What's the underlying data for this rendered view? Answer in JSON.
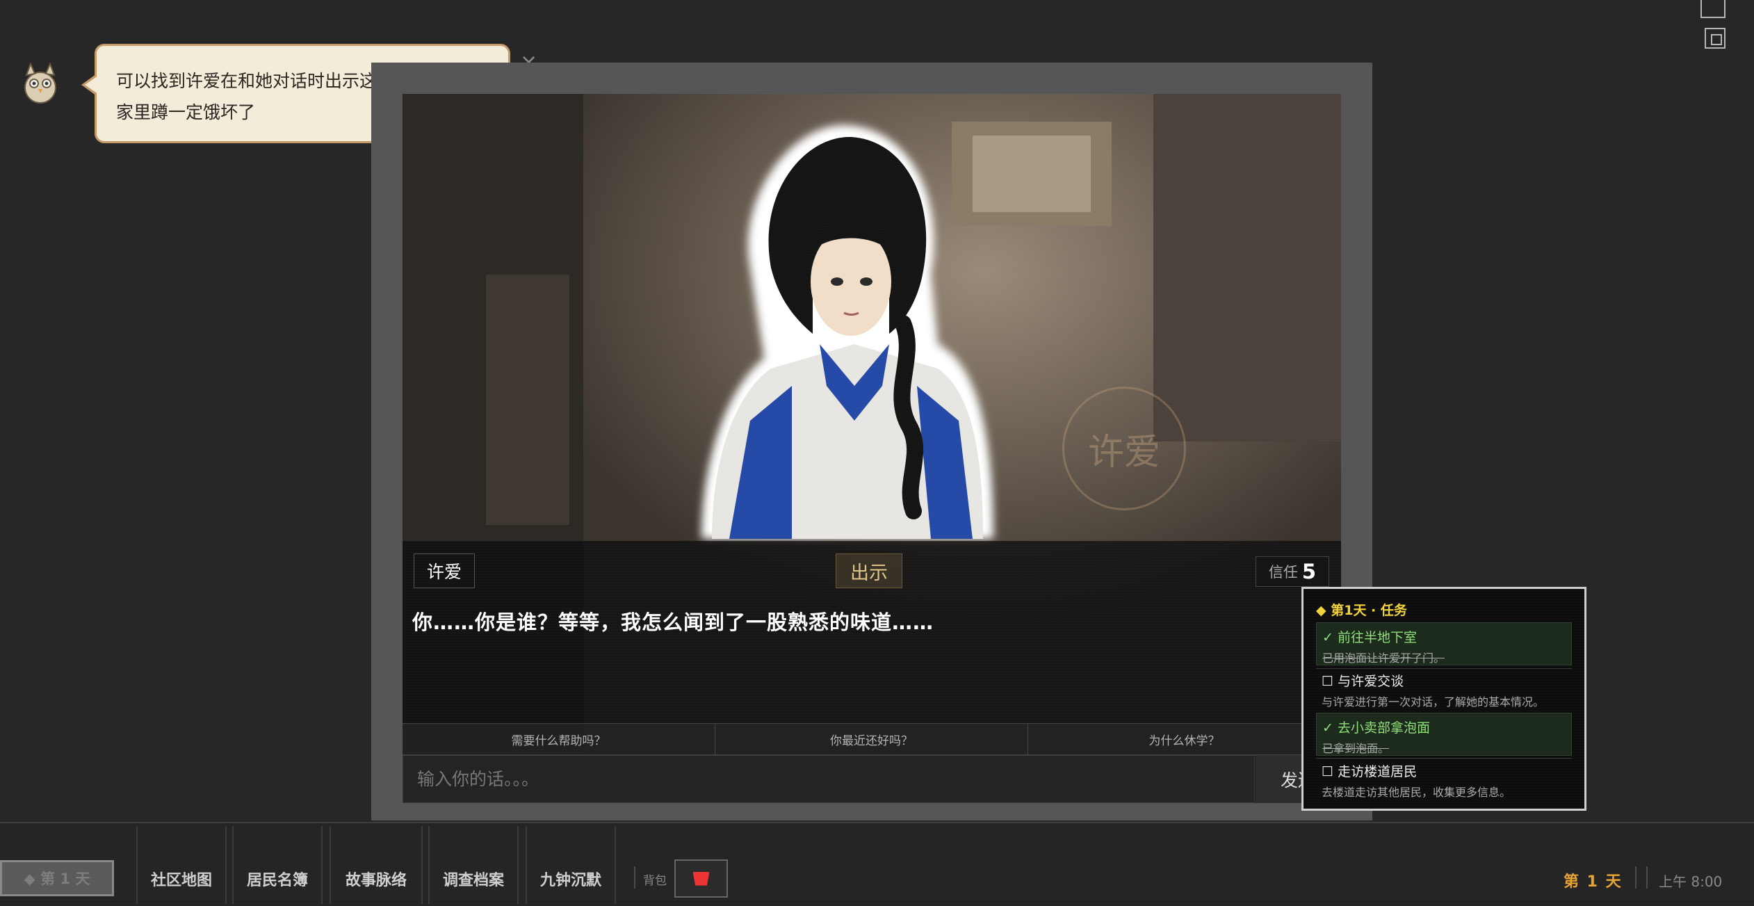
{
  "hint": {
    "text": "可以找到许爱在和她对话时出示这碗泡面，这个家里蹲一定饿坏了",
    "close": "×"
  },
  "scene": {
    "seal_text": "许爱"
  },
  "dialog": {
    "speaker": "许爱",
    "show_label": "出示",
    "trust_label": "信任",
    "trust_value": "5",
    "line": "你……你是谁？等等，我怎么闻到了一股熟悉的味道……"
  },
  "suggestions": [
    "需要什么帮助吗？",
    "你最近还好吗？",
    "为什么休学？"
  ],
  "input": {
    "placeholder": "输入你的话。。。",
    "send_label": "发送"
  },
  "quest": {
    "title": "◆ 第1天 · 任务",
    "items": [
      {
        "name": "✓ 前往半地下室",
        "desc": "已用泡面让许爱开了门。",
        "done": true
      },
      {
        "name": "☐ 与许爱交谈",
        "desc": "与许爱进行第一次对话，了解她的基本情况。",
        "done": false
      },
      {
        "name": "✓ 去小卖部拿泡面",
        "desc": "已拿到泡面。",
        "done": true
      },
      {
        "name": "☐ 走访楼道居民",
        "desc": "去楼道走访其他居民，收集更多信息。",
        "done": false
      }
    ]
  },
  "bottom": {
    "day_button": "◆ 第 1 天",
    "nav": [
      "社区地图",
      "居民名簿",
      "故事脉络",
      "调查档案",
      "九钟沉默"
    ],
    "bag_label": "背包",
    "day_counter": "第 1 天",
    "time": "上午 8:00"
  },
  "colors": {
    "accent_gold": "#e6a532",
    "quest_title": "#f2d23a",
    "done_green": "#8fe07a",
    "bubble_bg": "#f3ecd9"
  }
}
